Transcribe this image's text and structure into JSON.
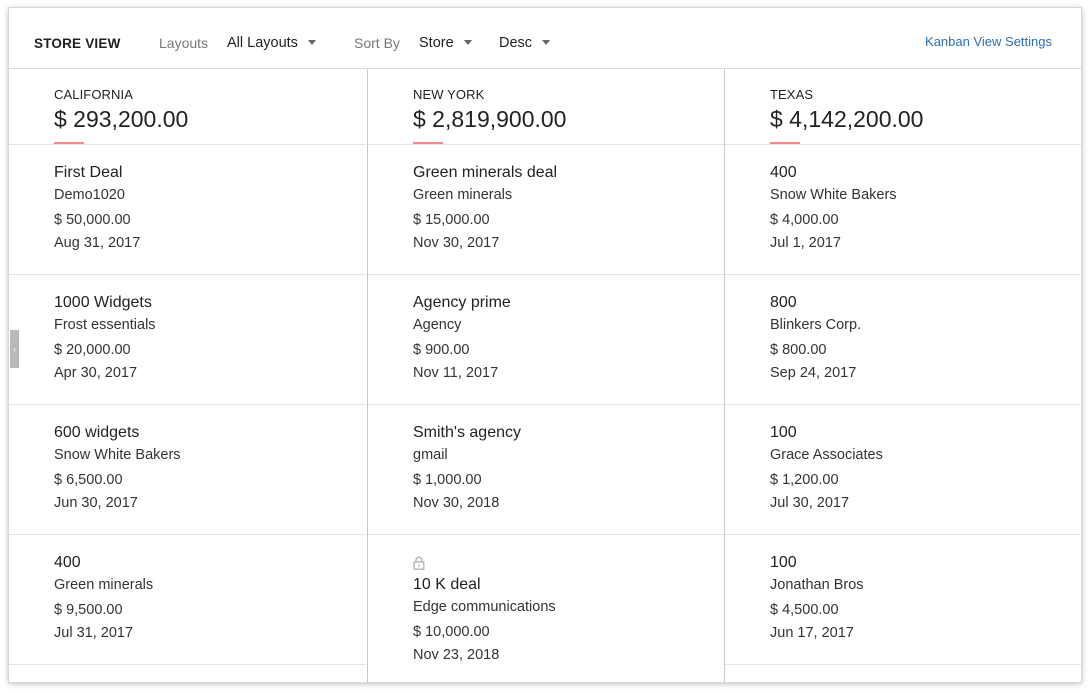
{
  "toolbar": {
    "title": "STORE VIEW",
    "layouts_label": "Layouts",
    "layouts_value": "All Layouts",
    "sort_label": "Sort By",
    "sort_field": "Store",
    "sort_order": "Desc",
    "settings_link": "Kanban View Settings"
  },
  "accent_color": "#f18b8b",
  "link_color": "#2c6fb5",
  "columns": [
    {
      "name": "CALIFORNIA",
      "total": "$ 293,200.00",
      "cards": [
        {
          "title": "First Deal",
          "account": "Demo1020",
          "amount": "$ 50,000.00",
          "date": "Aug 31, 2017"
        },
        {
          "title": "1000 Widgets",
          "account": "Frost essentials",
          "amount": "$ 20,000.00",
          "date": "Apr 30, 2017"
        },
        {
          "title": "600 widgets",
          "account": "Snow White Bakers",
          "amount": "$ 6,500.00",
          "date": "Jun 30, 2017"
        },
        {
          "title": "400",
          "account": "Green minerals",
          "amount": "$ 9,500.00",
          "date": "Jul 31, 2017"
        }
      ]
    },
    {
      "name": "NEW YORK",
      "total": "$ 2,819,900.00",
      "cards": [
        {
          "title": "Green minerals deal",
          "account": "Green minerals",
          "amount": "$ 15,000.00",
          "date": "Nov 30, 2017"
        },
        {
          "title": "Agency prime",
          "account": "Agency",
          "amount": "$ 900.00",
          "date": "Nov 11, 2017"
        },
        {
          "title": "Smith's agency",
          "account": "gmail",
          "amount": "$ 1,000.00",
          "date": "Nov 30, 2018"
        },
        {
          "title": "10 K deal",
          "account": "Edge communications",
          "amount": "$ 10,000.00",
          "date": "Nov 23, 2018",
          "locked": true,
          "icon": "lock-icon"
        }
      ]
    },
    {
      "name": "TEXAS",
      "total": "$ 4,142,200.00",
      "cards": [
        {
          "title": "400",
          "account": "Snow White Bakers",
          "amount": "$ 4,000.00",
          "date": "Jul 1, 2017"
        },
        {
          "title": "800",
          "account": "Blinkers Corp.",
          "amount": "$ 800.00",
          "date": "Sep 24, 2017"
        },
        {
          "title": "100",
          "account": "Grace Associates",
          "amount": "$ 1,200.00",
          "date": "Jul 30, 2017"
        },
        {
          "title": "100",
          "account": "Jonathan Bros",
          "amount": "$ 4,500.00",
          "date": "Jun 17, 2017"
        }
      ]
    }
  ]
}
